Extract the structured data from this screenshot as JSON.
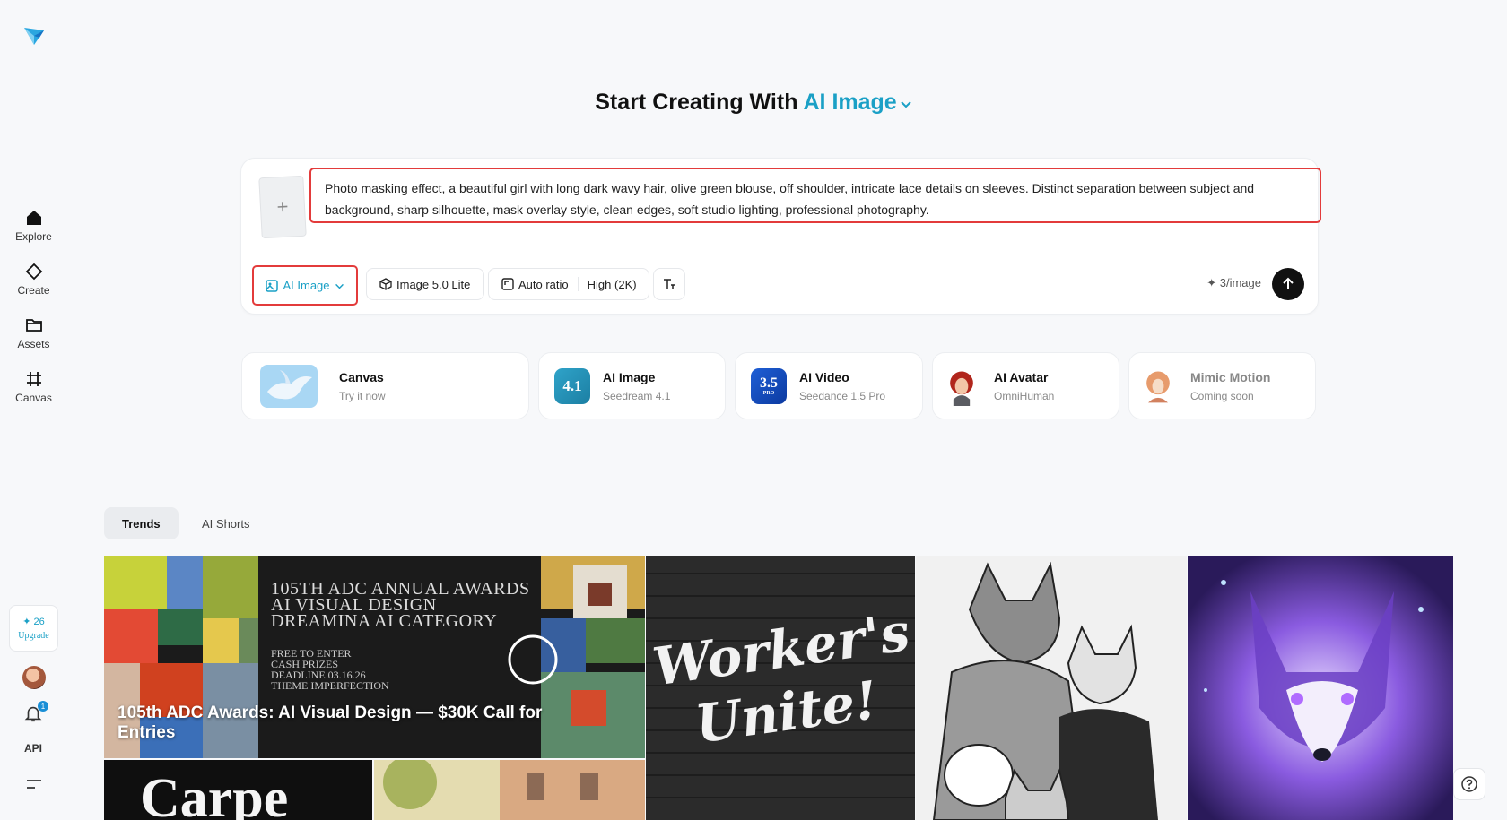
{
  "sidebar": {
    "nav": [
      {
        "label": "Explore",
        "icon": "home-icon"
      },
      {
        "label": "Create",
        "icon": "diamond-icon"
      },
      {
        "label": "Assets",
        "icon": "folder-icon"
      },
      {
        "label": "Canvas",
        "icon": "canvas-icon"
      }
    ],
    "credits": "✦ 26",
    "upgrade": "Upgrade",
    "notifications": "1",
    "api": "API"
  },
  "heading": {
    "prefix": "Start Creating With",
    "accent": "AI Image"
  },
  "composer": {
    "prompt": "Photo masking effect, a beautiful girl with long dark wavy hair, olive green blouse, off shoulder, intricate lace details on sleeves. Distinct separation between subject and background, sharp silhouette, mask overlay style, clean edges, soft studio lighting, professional photography.",
    "add_reference": "+",
    "type_label": "AI Image",
    "model_label": "Image 5.0 Lite",
    "ratio_label": "Auto ratio",
    "quality_label": "High (2K)",
    "cost": "✦ 3/image"
  },
  "shortcuts": [
    {
      "title": "Canvas",
      "subtitle": "Try it now"
    },
    {
      "title": "AI Image",
      "subtitle": "Seedream 4.1",
      "badge": "4.1"
    },
    {
      "title": "AI Video",
      "subtitle": "Seedance 1.5 Pro",
      "badge": "3.5",
      "badge_sub": "PRO"
    },
    {
      "title": "AI Avatar",
      "subtitle": "OmniHuman"
    },
    {
      "title": "Mimic Motion",
      "subtitle": "Coming soon"
    }
  ],
  "tabs": [
    "Trends",
    "AI Shorts"
  ],
  "gallery": {
    "featured_caption": "105th ADC Awards: AI Visual Design — $30K Call for Entries",
    "poster_lines": [
      "105TH ADC ANNUAL AWARDS",
      "AI VISUAL DESIGN",
      "DREAMINA AI CATEGORY"
    ],
    "poster_small": [
      "FREE TO ENTER",
      "CASH PRIZES",
      "DEADLINE 03.16.26",
      "THEME IMPERFECTION"
    ],
    "graffiti_lines": [
      "Worker's",
      "Unite!"
    ],
    "carpe": "Carpe"
  },
  "colors": {
    "accent": "#1aa0c6",
    "highlight": "#e33b3b"
  }
}
